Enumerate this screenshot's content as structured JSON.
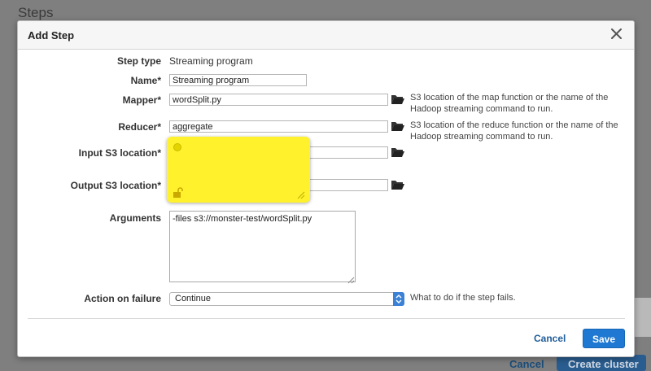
{
  "background": {
    "title": "Steps",
    "cancel_label": "Cancel",
    "create_label": "Create cluster"
  },
  "modal": {
    "title": "Add Step",
    "close_icon": "close-icon",
    "step_type": {
      "label": "Step type",
      "value": "Streaming program"
    },
    "name": {
      "label": "Name*",
      "value": "Streaming program"
    },
    "mapper": {
      "label": "Mapper*",
      "value": "wordSplit.py",
      "help_line1": "S3 location of the map function or the name of the",
      "help_line2": "Hadoop streaming command to run."
    },
    "reducer": {
      "label": "Reducer*",
      "value": "aggregate",
      "help_line1": "S3 location of the reduce function or the name of the",
      "help_line2": "Hadoop streaming command to run."
    },
    "input_s3": {
      "label": "Input S3 location*",
      "value": ""
    },
    "output_s3": {
      "label": "Output S3 location*",
      "value": ""
    },
    "arguments": {
      "label": "Arguments",
      "value": "-files s3://monster-test/wordSplit.py"
    },
    "action_on_failure": {
      "label": "Action on failure",
      "selected": "Continue",
      "help": "What to do if the step fails."
    },
    "buttons": {
      "cancel": "Cancel",
      "save": "Save"
    }
  },
  "sticky_note": {
    "color": "#fff12c",
    "text": ""
  },
  "colors": {
    "primary": "#1f78d1",
    "link": "#1f5d99",
    "overlay": "#7f7f7f"
  }
}
